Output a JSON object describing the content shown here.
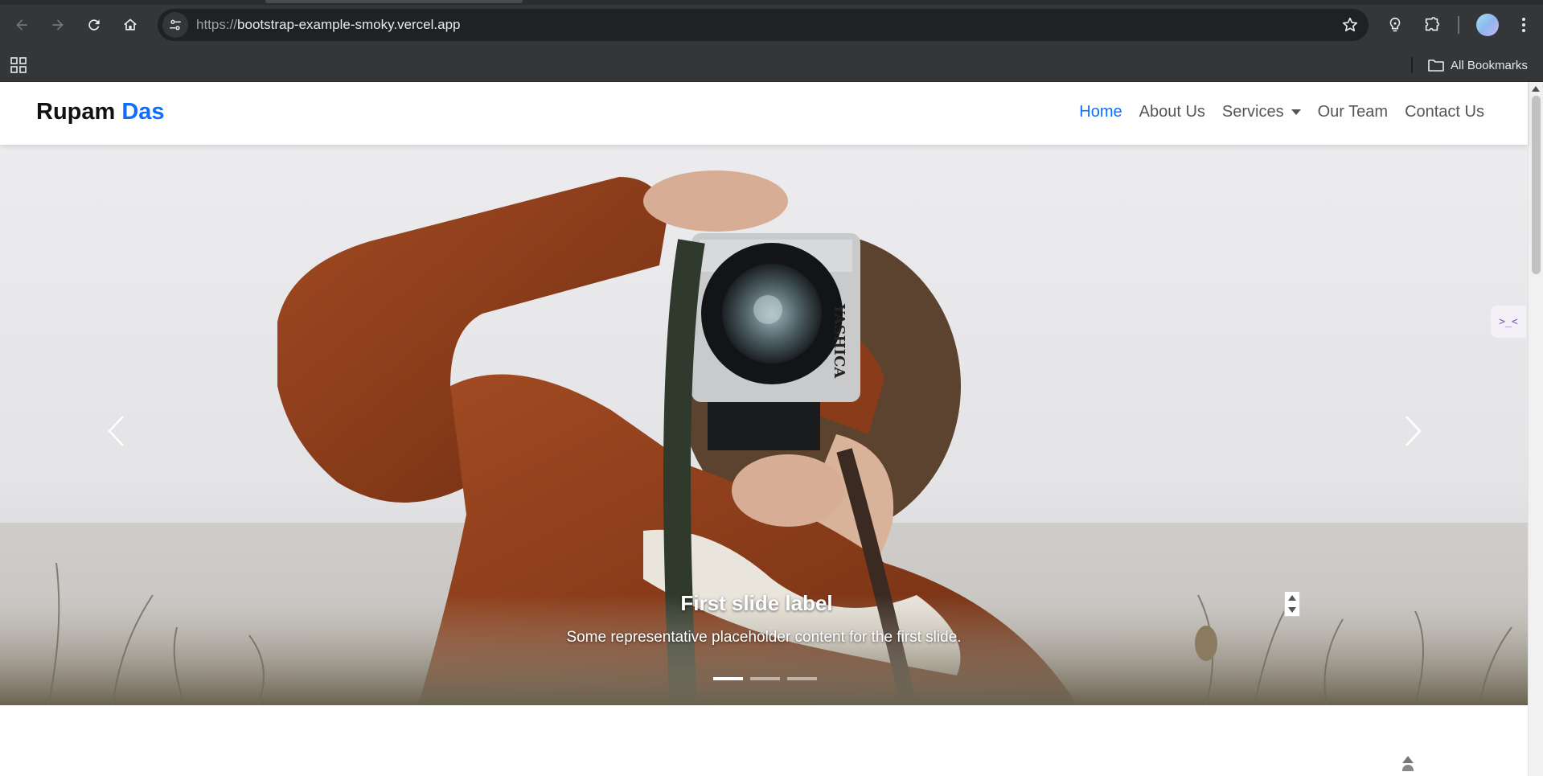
{
  "browser": {
    "url_scheme": "https://",
    "url_host": "bootstrap-example-smoky.vercel.app",
    "bookmarks_label": "All Bookmarks",
    "icons": [
      "back-icon",
      "forward-icon",
      "reload-icon",
      "home-icon",
      "site-info-icon",
      "star-icon",
      "lightbulb-extension-icon",
      "puzzle-extensions-icon",
      "profile-avatar",
      "kebab-menu-icon",
      "apps-grid-icon",
      "folder-icon"
    ]
  },
  "navbar": {
    "brand_first": "Rupam",
    "brand_second": "Das",
    "brand_accent_color": "#0d6efd",
    "links": [
      {
        "label": "Home",
        "active": true
      },
      {
        "label": "About Us",
        "active": false
      },
      {
        "label": "Services",
        "active": false,
        "dropdown": true
      },
      {
        "label": "Our Team",
        "active": false
      },
      {
        "label": "Contact Us",
        "active": false
      }
    ]
  },
  "carousel": {
    "caption_title": "First slide label",
    "caption_text": "Some representative placeholder content for the first slide.",
    "camera_brand": "YASHICA",
    "slide_count": 3,
    "active_slide": 1
  },
  "side_widget": {
    "glyph": ">_<"
  }
}
